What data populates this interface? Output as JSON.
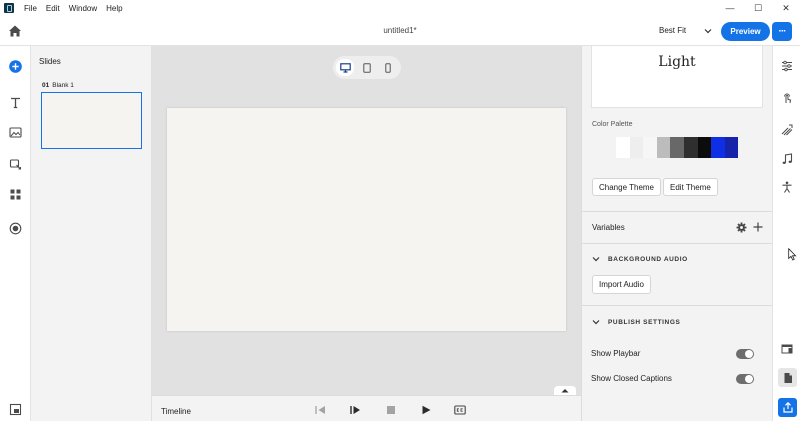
{
  "menu": {
    "items": [
      "File",
      "Edit",
      "Window",
      "Help"
    ]
  },
  "window_controls": {
    "minimize": "—",
    "maximize": "☐",
    "close": "✕"
  },
  "header": {
    "title": "untitled1*",
    "fit_value": "Best Fit",
    "preview_label": "Preview",
    "more_label": "···"
  },
  "slides_panel": {
    "title": "Slides",
    "slides": [
      {
        "number": "01",
        "name": "Blank 1"
      }
    ]
  },
  "timeline": {
    "label": "Timeline"
  },
  "properties": {
    "theme_name": "Light",
    "color_palette_label": "Color Palette",
    "palette_colors": [
      "#ffffff",
      "#eeeeee",
      "#f6f6f6",
      "#bcbcbc",
      "#686868",
      "#2f2f2f",
      "#0c0c0c",
      "#0f2fe6",
      "#1524a8"
    ],
    "change_theme_label": "Change Theme",
    "edit_theme_label": "Edit Theme",
    "variables_label": "Variables",
    "background_audio_heading": "BACKGROUND AUDIO",
    "import_audio_label": "Import Audio",
    "publish_settings_heading": "PUBLISH SETTINGS",
    "show_playbar_label": "Show Playbar",
    "show_playbar_on": true,
    "show_closed_captions_label": "Show Closed Captions",
    "show_closed_captions_on": true
  },
  "colors": {
    "accent": "#1473e6",
    "panel_bg": "#f3f3f3",
    "canvas_bg": "#e1e1e1",
    "slide_bg": "#f5f4f1"
  }
}
